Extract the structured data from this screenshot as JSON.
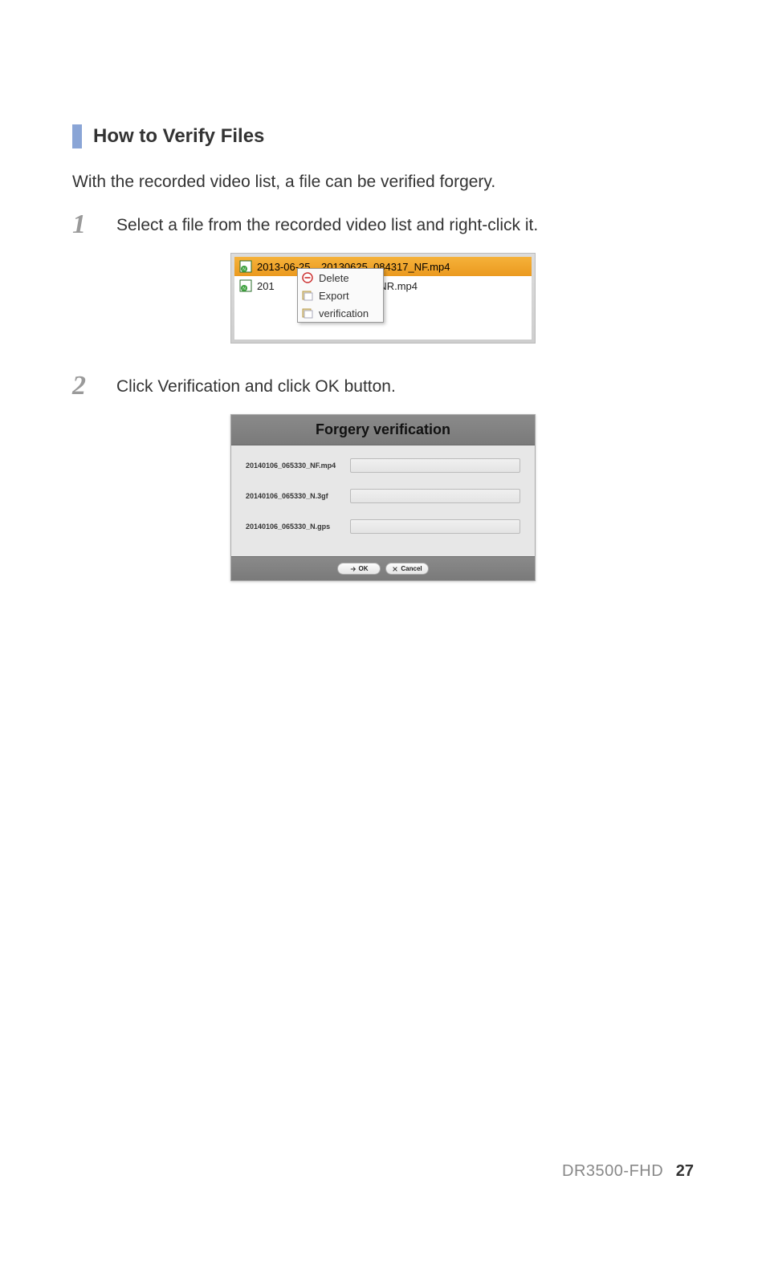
{
  "heading": "How to Verify Files",
  "intro": "With the recorded video list, a file can be verified forgery.",
  "steps": [
    {
      "num": "1",
      "text": "Select a file from the recorded video list and right-click it."
    },
    {
      "num": "2",
      "text": "Click Verification and click OK button."
    }
  ],
  "file_list": {
    "rows": [
      {
        "date": "2013-06-25",
        "name": "20130625_084317_NF.mp4"
      },
      {
        "date": "201",
        "name": "25_084317_NR.mp4"
      }
    ]
  },
  "context_menu": {
    "items": [
      "Delete",
      "Export",
      "verification"
    ]
  },
  "dialog": {
    "title": "Forgery verification",
    "rows": [
      "20140106_065330_NF.mp4",
      "20140106_065330_N.3gf",
      "20140106_065330_N.gps"
    ],
    "ok": "OK",
    "cancel": "Cancel"
  },
  "footer": {
    "model": "DR3500-FHD",
    "page": "27"
  }
}
